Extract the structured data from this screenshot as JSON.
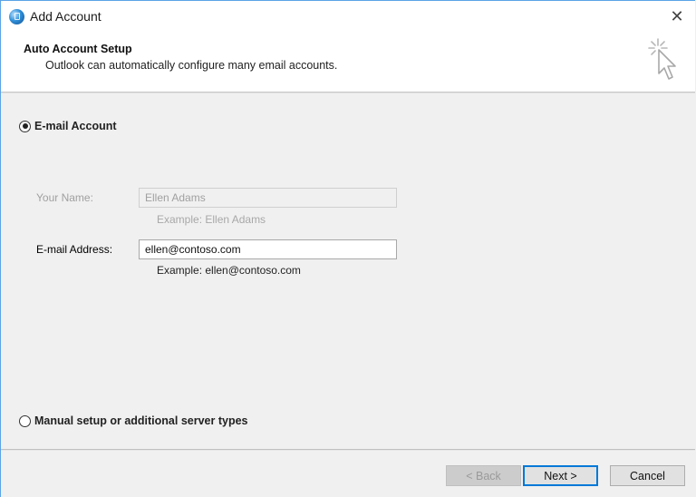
{
  "window": {
    "title": "Add Account",
    "close_label": "✕"
  },
  "header": {
    "title": "Auto Account Setup",
    "subtitle": "Outlook can automatically configure many email accounts."
  },
  "options": {
    "email_account": {
      "label": "E-mail Account",
      "selected": true
    },
    "manual_setup": {
      "label": "Manual setup or additional server types",
      "selected": false
    }
  },
  "form": {
    "your_name": {
      "label": "Your Name:",
      "value": "Ellen Adams",
      "example": "Example: Ellen Adams",
      "enabled": false
    },
    "email_address": {
      "label": "E-mail Address:",
      "value": "ellen@contoso.com",
      "example": "Example: ellen@contoso.com",
      "enabled": true
    }
  },
  "buttons": {
    "back": "< Back",
    "next": "Next >",
    "cancel": "Cancel"
  },
  "colors": {
    "accent": "#0078d7",
    "window_border": "#5aa4e6",
    "body_bg": "#f0f0f0"
  }
}
